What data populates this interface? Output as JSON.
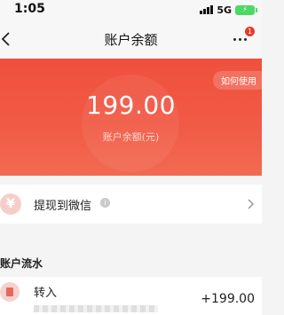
{
  "status_bar": {
    "time": "1:05",
    "network": "5G",
    "battery_icon": "battery-charging-icon"
  },
  "nav": {
    "title": "账户余额",
    "back_icon": "chevron-left-icon",
    "more_icon": "more-dots-icon",
    "badge_count": "1"
  },
  "balance_card": {
    "help_label": "如何使用",
    "amount": "199.00",
    "label": "账户余额(元)",
    "accent_color": "#f0503e"
  },
  "withdraw": {
    "icon_symbol": "¥",
    "label": "提现到微信",
    "info_icon": "info-icon",
    "chevron_icon": "chevron-right-icon"
  },
  "transactions": {
    "section_title": "账户流水",
    "items": [
      {
        "title": "转入",
        "amount": "+199.00",
        "icon": "transfer-in-icon"
      }
    ]
  }
}
